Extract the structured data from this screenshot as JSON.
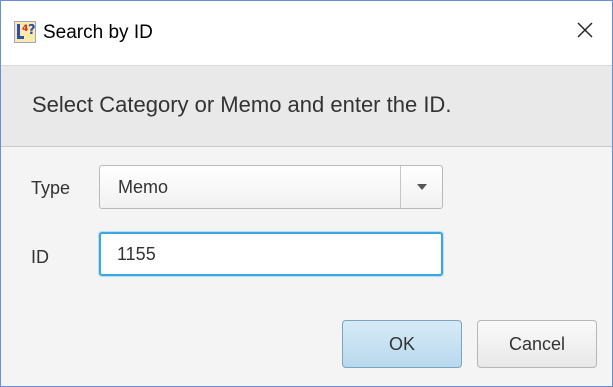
{
  "window": {
    "title": "Search by ID",
    "app_icon": "app-logo-icon",
    "close_icon": "close-icon"
  },
  "header": {
    "text": "Select Category or Memo and enter the ID."
  },
  "form": {
    "type_label": "Type",
    "type_value": "Memo",
    "id_label": "ID",
    "id_value": "1155"
  },
  "buttons": {
    "ok_label": "OK",
    "cancel_label": "Cancel"
  },
  "colors": {
    "focus_border": "#39a7e0",
    "default_button": "#c5e1f2",
    "window_border": "#6a8fd0"
  }
}
